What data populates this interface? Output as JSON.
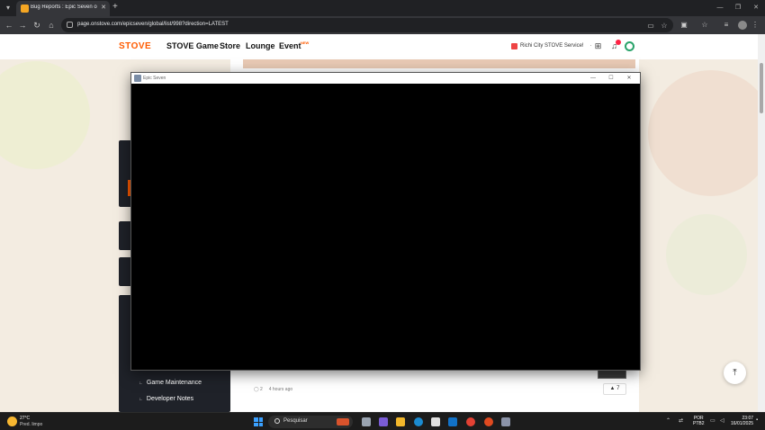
{
  "browser": {
    "tab_title": "Bug Reports : Epic Seven on STOVE",
    "new_tab_symbol": "+",
    "url": "page.onstove.com/epicseven/global/list/998?direction=LATEST"
  },
  "site": {
    "logo": "STOVE",
    "nav": [
      "STOVE Game",
      "Store",
      "Lounge",
      "Event"
    ],
    "event_badge": "NEW",
    "service_label": "Richi City STOVE Service!",
    "notification_count": "6"
  },
  "sidebar": {
    "links": [
      "Game Maintenance",
      "Developer Notes"
    ]
  },
  "content": {
    "comment_count": "2",
    "post_time": "4 hours ago",
    "vote_count": "▲ 7"
  },
  "game_window": {
    "title": "Epic Seven"
  },
  "taskbar": {
    "weather_temp": "27°C",
    "weather_desc": "Pred. limpo",
    "search_placeholder": "Pesquisar",
    "lang_line1": "POR",
    "lang_line2": "PTB2",
    "time": "23:07",
    "date": "16/01/2025"
  },
  "colors": {
    "brand": "#ff5b00",
    "page_bg": "#f3ece1",
    "sidebar_bg": "#1f2229"
  }
}
